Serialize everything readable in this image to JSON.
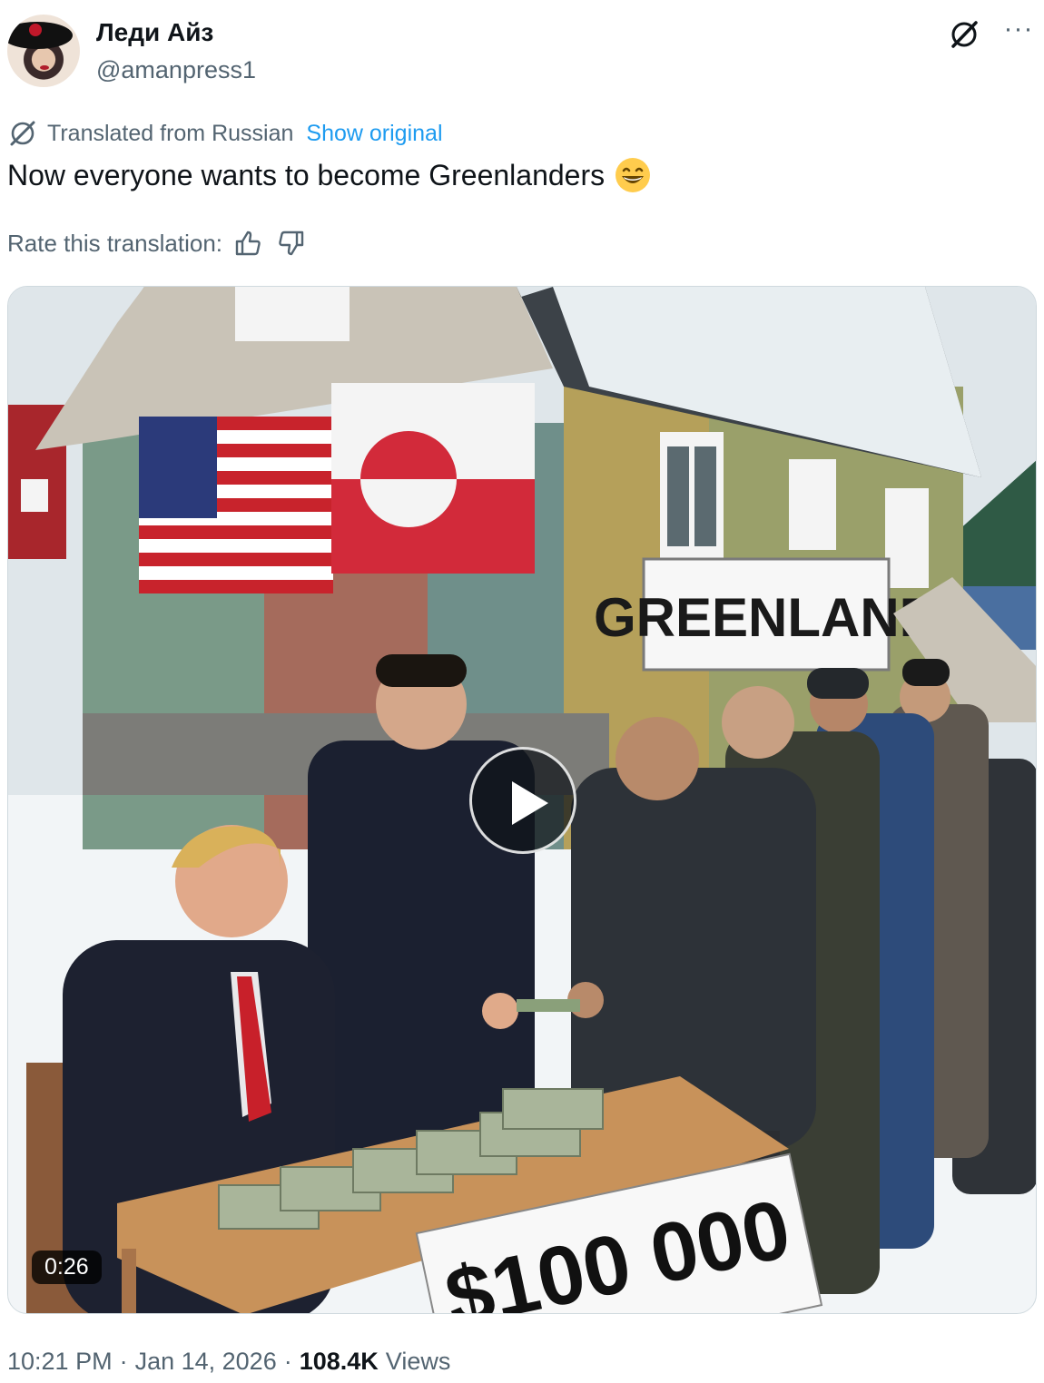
{
  "author": {
    "display_name": "Леди Айз",
    "handle": "@amanpress1"
  },
  "icons": {
    "grok": "grok-icon",
    "more": "more-icon",
    "translate": "translate-icon",
    "thumbs_up": "thumbs-up-icon",
    "thumbs_down": "thumbs-down-icon",
    "play": "play-icon",
    "emoji": "grinning-face-emoji"
  },
  "more_glyph": "···",
  "translation": {
    "label": "Translated from Russian",
    "show_original": "Show original"
  },
  "tweet": {
    "text": "Now everyone wants to become Greenlanders"
  },
  "rate": {
    "label": "Rate this translation:"
  },
  "media": {
    "duration": "0:26",
    "sign_greenland": "GREENLAND",
    "sign_amount": "$100 000"
  },
  "meta": {
    "time": "10:21 PM",
    "separator": "·",
    "date": "Jan 14, 2026",
    "views_count": "108.4K",
    "views_label": "Views"
  },
  "colors": {
    "link": "#1d9bf0",
    "secondary_text": "#536471",
    "primary_text": "#0f1419"
  }
}
